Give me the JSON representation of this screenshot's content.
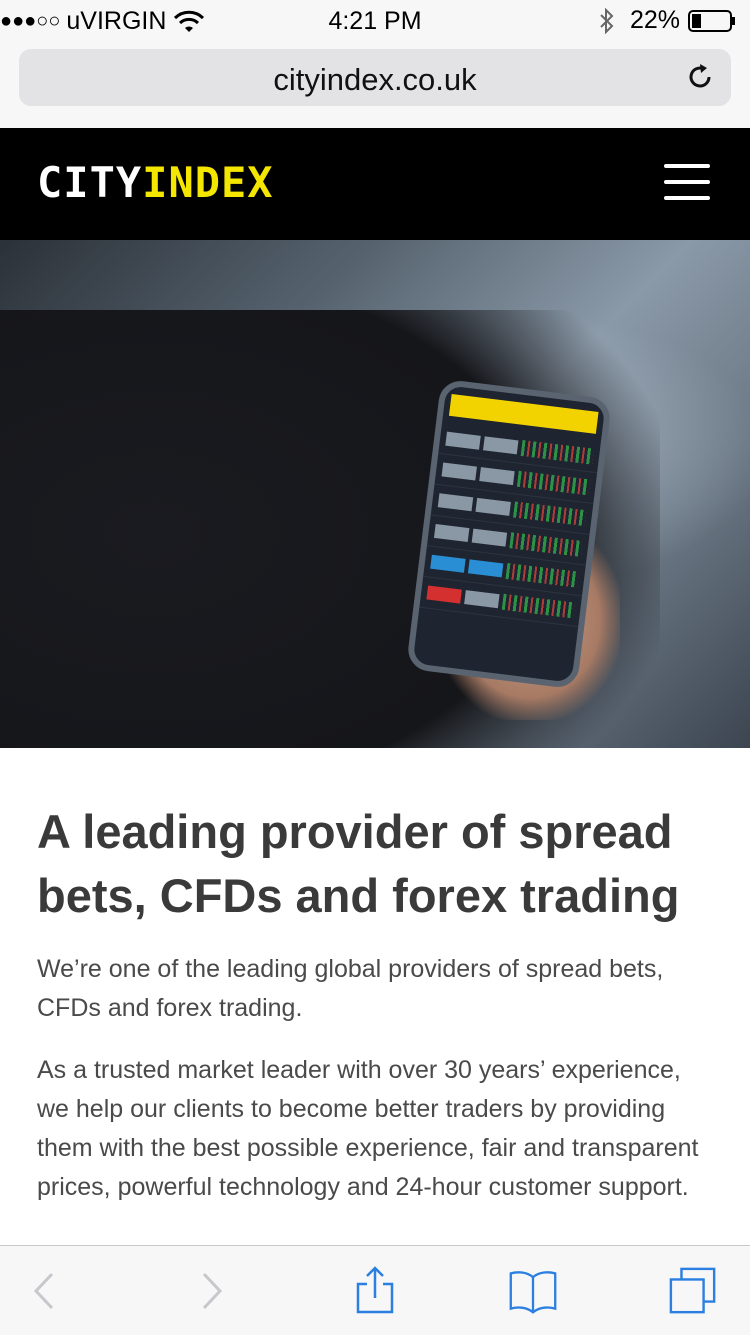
{
  "status_bar": {
    "signal": "●●●○○",
    "carrier": "uVIRGIN",
    "time": "4:21 PM",
    "battery": "22%",
    "icons": [
      "wifi-icon",
      "bluetooth-icon",
      "battery-icon"
    ]
  },
  "browser": {
    "url": "cityindex.co.uk",
    "reload_icon": "reload-icon"
  },
  "header": {
    "logo_part1": "CITY",
    "logo_part2": "INDEX",
    "menu_icon": "hamburger-menu-icon",
    "logo_colors": {
      "city": "#ffffff",
      "index": "#f5e600"
    }
  },
  "hero": {
    "image": "person holding smartphone showing trading app"
  },
  "content": {
    "headline": "A leading provider of spread bets, CFDs and forex trading",
    "paragraph1": "We’re one of the leading global providers of spread bets, CFDs and forex trading.",
    "paragraph2": "As a trusted market leader with over 30 years’ experience, we help our clients to become better traders by providing them with the best possible experience, fair and transparent prices, powerful technology and 24-hour customer support."
  },
  "toolbar": {
    "icons": [
      "back-icon",
      "forward-icon",
      "share-icon",
      "bookmarks-icon",
      "tabs-icon"
    ],
    "accent": "#2a7fe0",
    "disabled": "#c7c7cc"
  }
}
